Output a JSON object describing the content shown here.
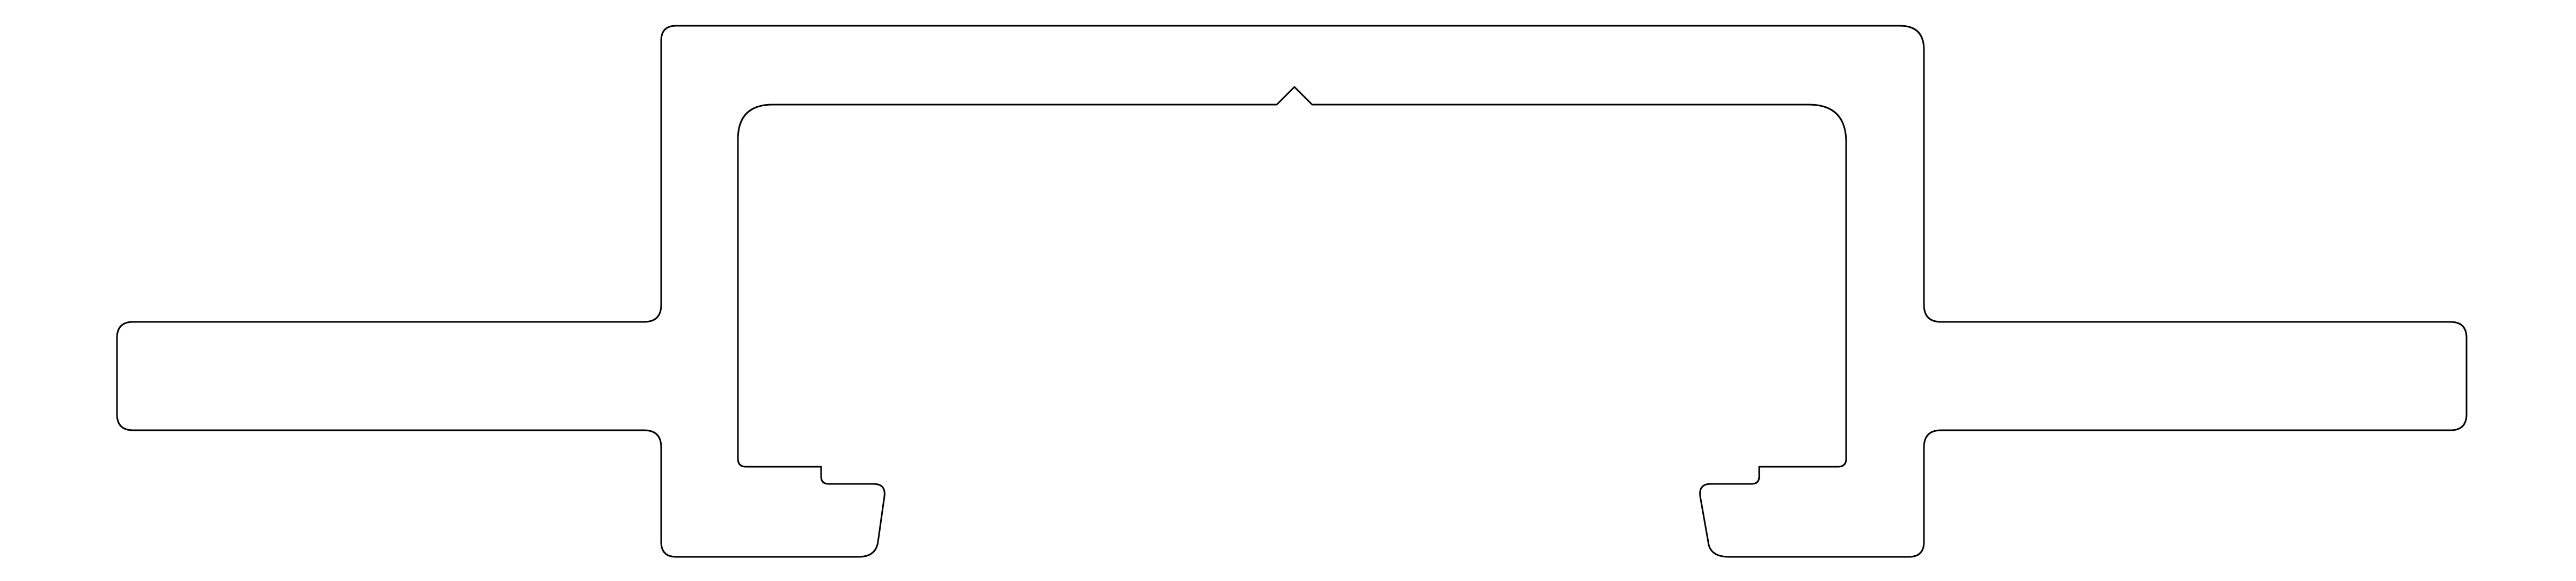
{
  "drawing": {
    "background_color": "#ffffff",
    "stroke_color": "#000000"
  }
}
